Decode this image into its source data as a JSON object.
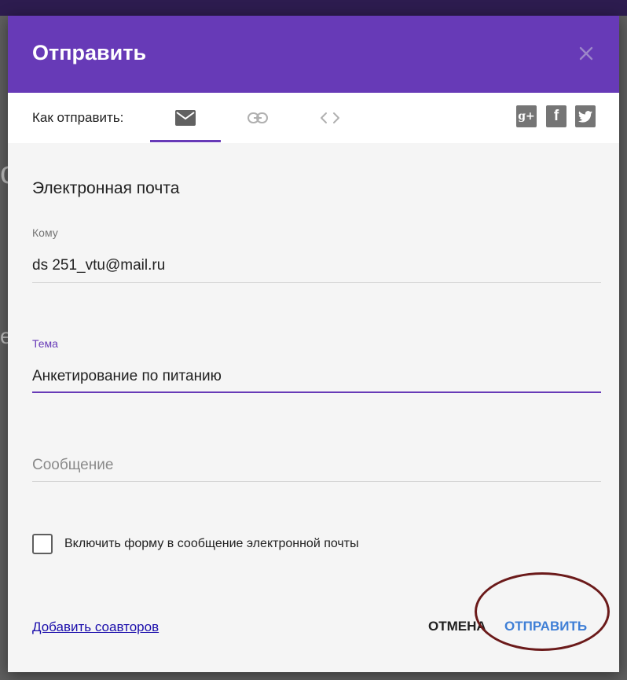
{
  "dialog": {
    "title": "Отправить",
    "close_icon": "close-icon"
  },
  "tabs": {
    "how_label": "Как отправить:",
    "items": [
      {
        "name": "email",
        "icon": "envelope-icon",
        "selected": true
      },
      {
        "name": "link",
        "icon": "link-icon",
        "selected": false
      },
      {
        "name": "embed",
        "icon": "code-icon",
        "selected": false
      }
    ],
    "social": [
      {
        "icon": "google-plus-icon",
        "glyph": "g+"
      },
      {
        "icon": "facebook-icon",
        "glyph": "f"
      },
      {
        "icon": "twitter-icon",
        "glyph": "t"
      }
    ]
  },
  "email_form": {
    "section_title": "Электронная почта",
    "to_label": "Кому",
    "to_value": "ds 251_vtu@mail.ru",
    "subject_label": "Тема",
    "subject_value": "Анкетирование по питанию",
    "message_placeholder": "Сообщение",
    "include_form_label": "Включить форму в сообщение электронной почты",
    "include_form_checked": false
  },
  "footer": {
    "add_collaborators": "Добавить соавторов",
    "cancel": "ОТМЕНА",
    "send": "ОТПРАВИТЬ"
  },
  "colors": {
    "accent": "#673ab7",
    "send_button": "#3f7fd6",
    "highlight_ellipse": "#6b1a1a"
  }
}
